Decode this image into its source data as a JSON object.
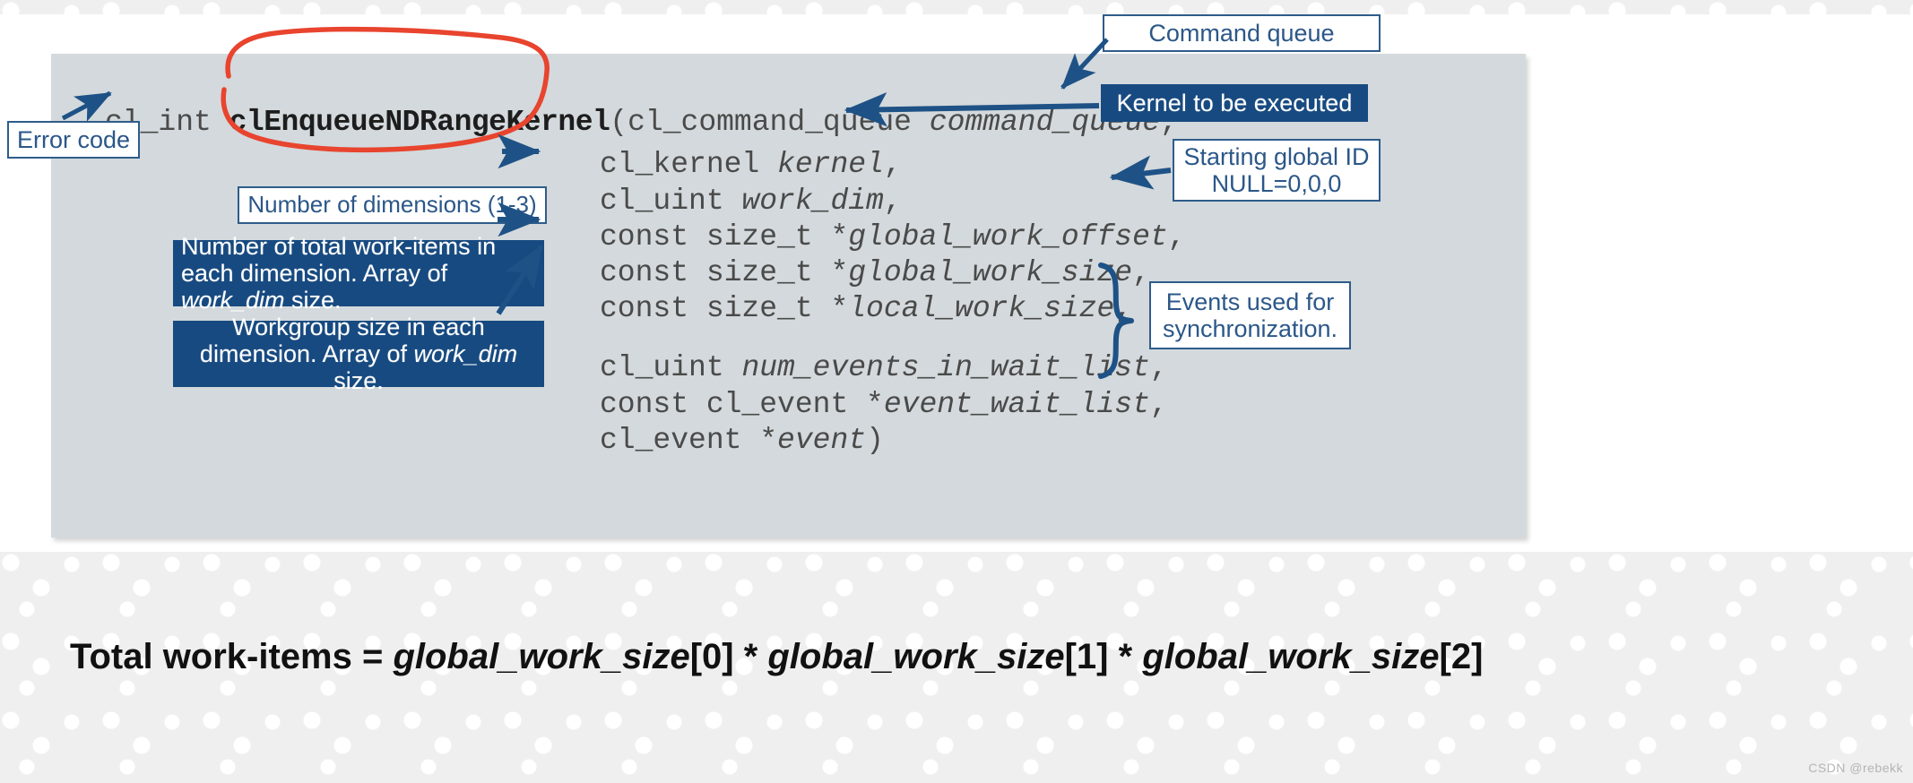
{
  "code": {
    "line1_pre": "cl_int ",
    "line1_name": "clEnqueueNDRangeKernel",
    "line1_post": "(cl_command_queue ",
    "line1_param": "command_queue",
    "line1_tail": ",",
    "lines": [
      {
        "type": "cl_kernel ",
        "param": "kernel",
        "tail": ","
      },
      {
        "type": "cl_uint ",
        "param": "work_dim",
        "tail": ","
      },
      {
        "type": "const size_t *",
        "param": "global_work_offset",
        "tail": ","
      },
      {
        "type": "const size_t *",
        "param": "global_work_size",
        "tail": ","
      },
      {
        "type": "const size_t *",
        "param": "local_work_size",
        "tail": ","
      },
      {
        "type": "cl_uint ",
        "param": "num_events_in_wait_list",
        "tail": ","
      },
      {
        "type": "const cl_event *",
        "param": "event_wait_list",
        "tail": ","
      },
      {
        "type": "cl_event *",
        "param": "event",
        "tail": ")"
      }
    ]
  },
  "callouts": {
    "error_code": "Error code",
    "num_dimensions": "Number of dimensions (1-3)",
    "total_work_items_a": "Number of total work-items in each dimension. Array of ",
    "total_work_items_em": "work_dim",
    "total_work_items_b": " size.",
    "workgroup_size_a": "Workgroup size in each dimension. Array of ",
    "workgroup_size_em": "work_dim",
    "workgroup_size_b": " size.",
    "command_queue": "Command queue",
    "kernel_to_be_executed": "Kernel to be executed",
    "starting_global_id_line1": "Starting global ID",
    "starting_global_id_line2": "NULL=0,0,0",
    "events_line1": "Events used for",
    "events_line2": "synchronization."
  },
  "formula": {
    "prefix": "Total work-items = ",
    "term1": "global_work_size",
    "idx1": "[0]",
    "op1": " * ",
    "term2": "global_work_size",
    "idx2": "[1]",
    "op2": " * ",
    "term3": "global_work_size",
    "idx3": "[2]"
  },
  "watermark": "CSDN @rebekk",
  "colors": {
    "panel_gray": "#d3d9dc",
    "accent_blue": "#174a80",
    "callout_border": "#2e5c8a",
    "callout_text": "#2b5788",
    "annotation_red": "#e8442e",
    "code_text": "#4a4a4a"
  }
}
